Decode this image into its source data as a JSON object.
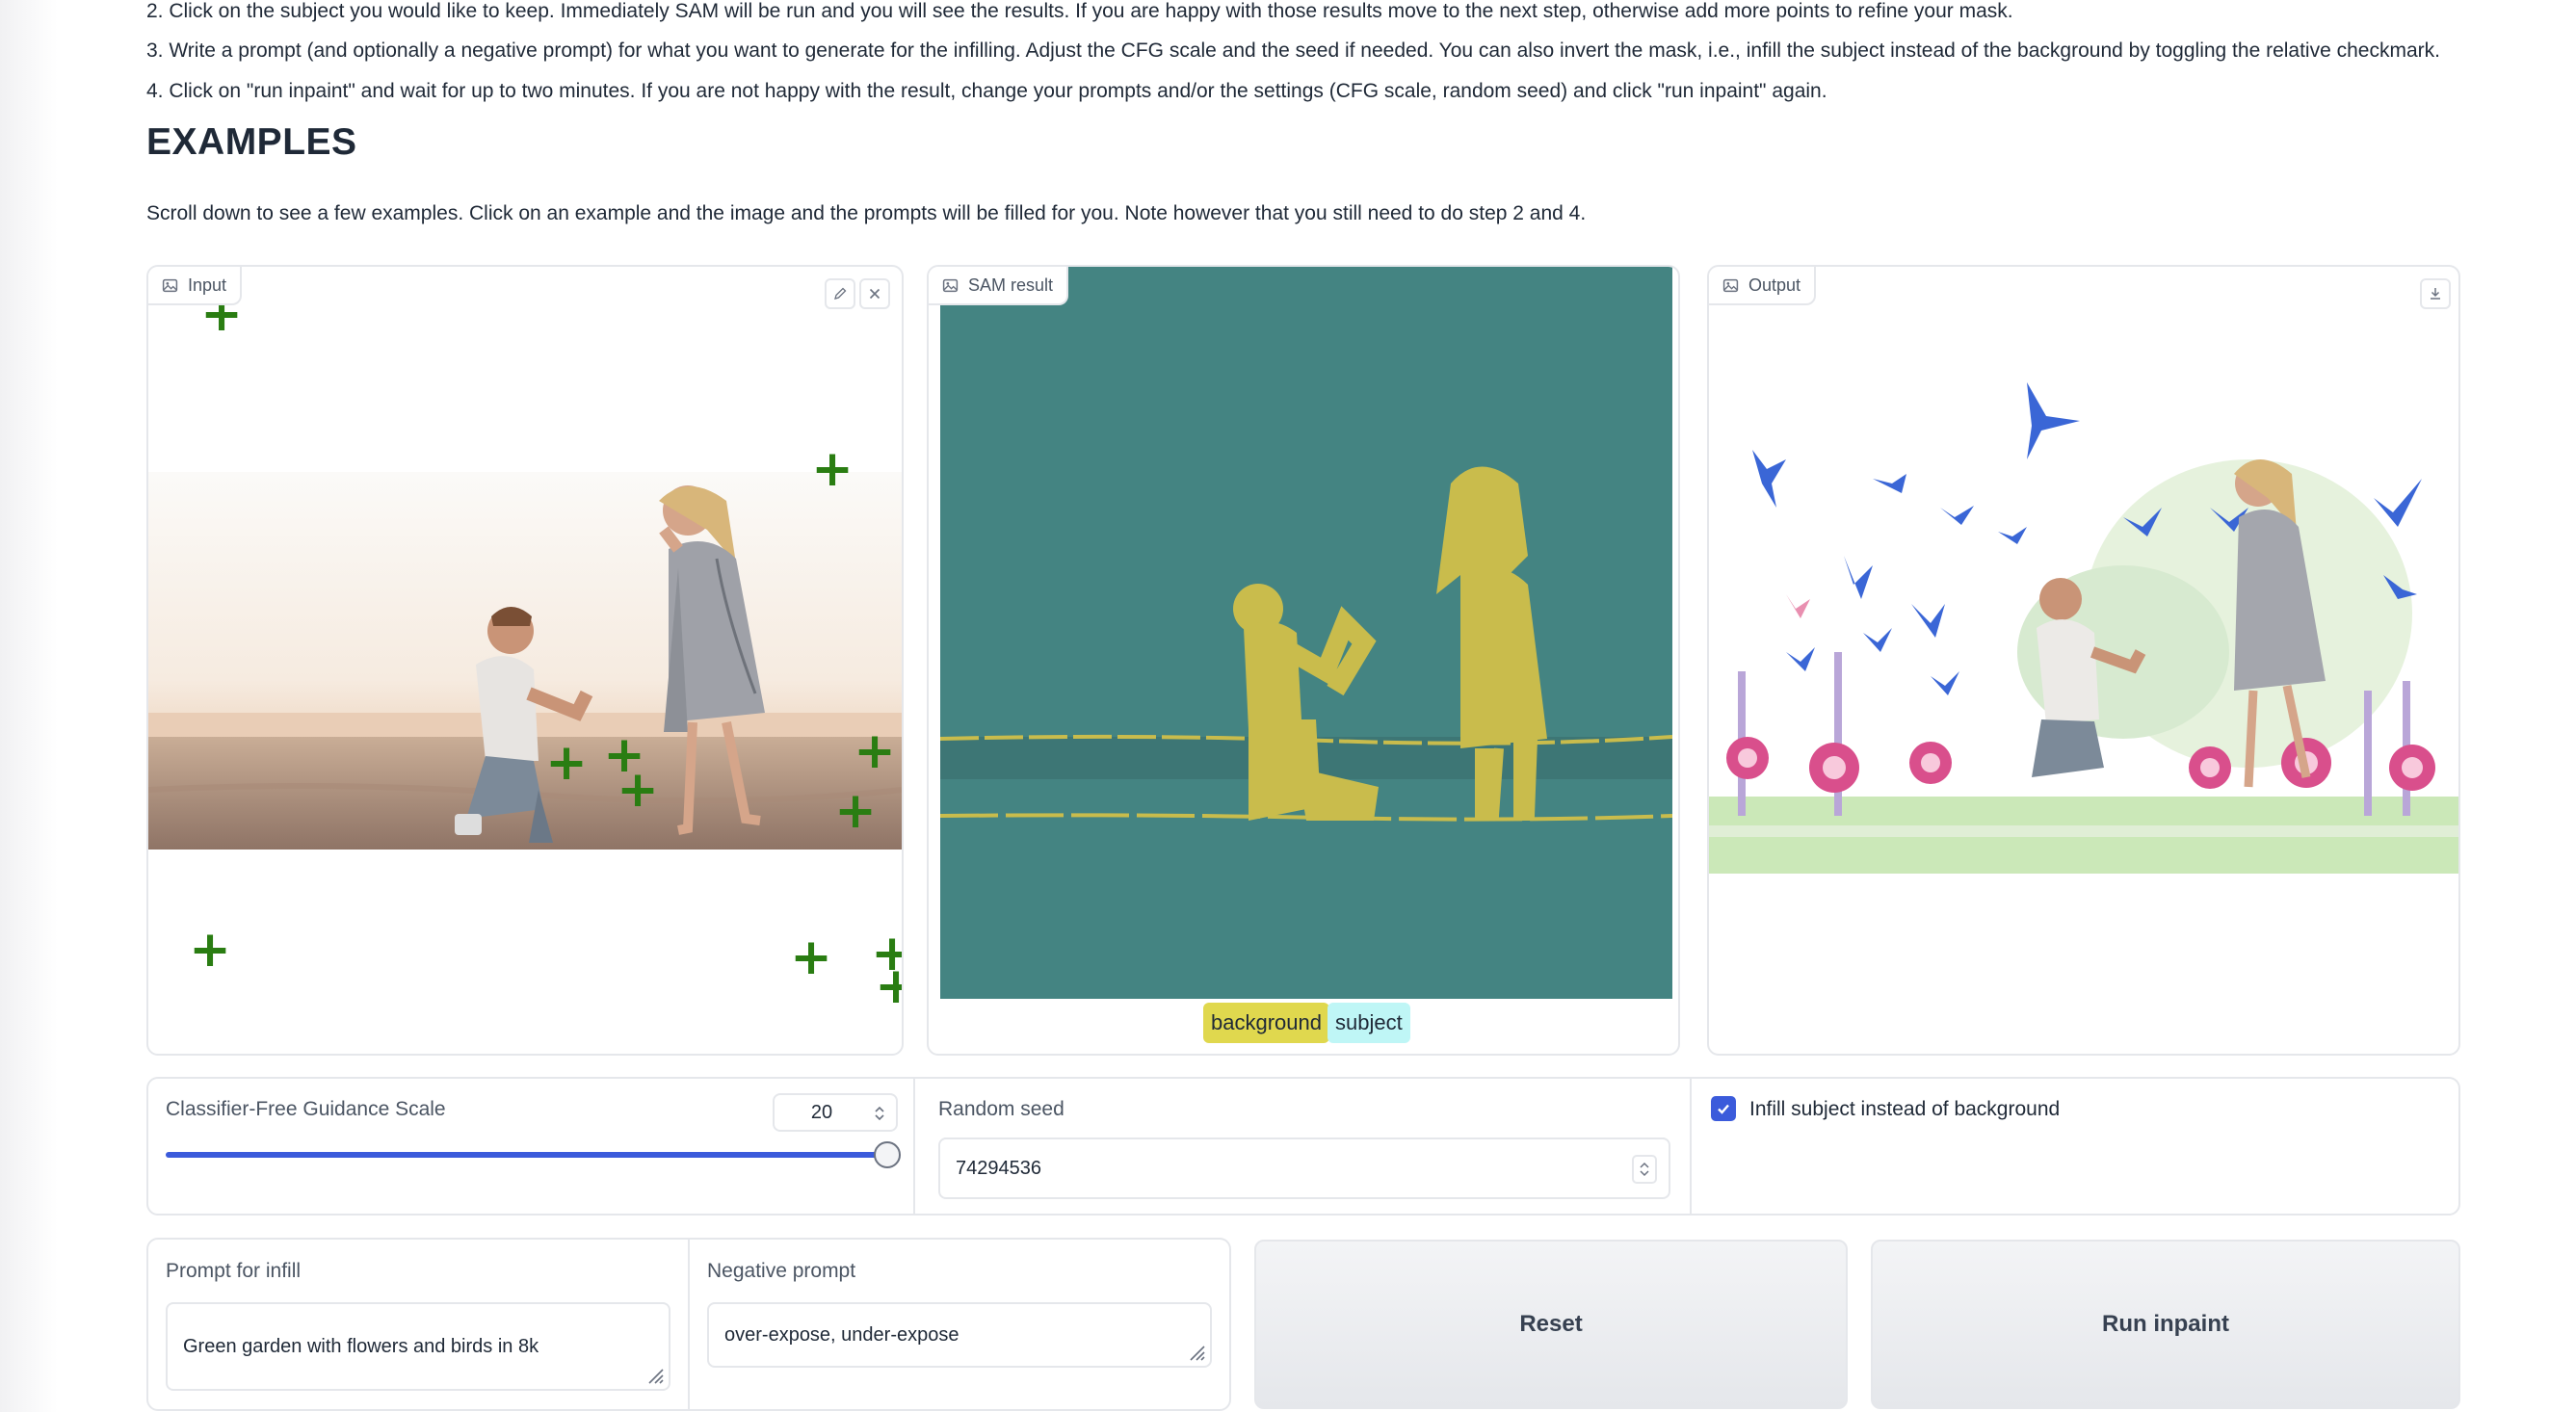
{
  "instructions": {
    "step2": "2. Click on the subject you would like to keep. Immediately SAM will be run and you will see the results. If you are happy with those results move to the next step, otherwise add more points to refine your mask.",
    "step3": "3. Write a prompt (and optionally a negative prompt) for what you want to generate for the infilling. Adjust the CFG scale and the seed if needed. You can also invert the mask, i.e., infill the subject instead of the background by toggling the relative checkmark.",
    "step4": "4. Click on \"run inpaint\" and wait for up to two minutes. If you are not happy with the result, change your prompts and/or the settings (CFG scale, random seed) and click \"run inpaint\" again."
  },
  "examples": {
    "heading": "EXAMPLES",
    "description": "Scroll down to see a few examples. Click on an example and the image and the prompts will be filled for you. Note however that you still need to do step 2 and 4."
  },
  "input_panel": {
    "label": "Input",
    "edit_icon": "pencil-icon",
    "close_icon": "close-icon"
  },
  "sam_panel": {
    "label": "SAM result",
    "legend": [
      "background",
      "subject"
    ],
    "colors": {
      "background_mask": "#e0d84e",
      "subject_mask": "#bff6f6",
      "teal_overlay": "#448482",
      "yellow_overlay": "#c9bc4c"
    }
  },
  "output_panel": {
    "label": "Output",
    "download_icon": "download-icon"
  },
  "cfg": {
    "label": "Classifier-Free Guidance Scale",
    "value": "20",
    "slider_fraction": 1.0,
    "accent": "#3b5bdb"
  },
  "seed": {
    "label": "Random seed",
    "value": "74294536"
  },
  "invert": {
    "label": "Infill subject instead of background",
    "checked": true
  },
  "prompt": {
    "label": "Prompt for infill",
    "value": "Green garden with flowers and birds in 8k"
  },
  "negative_prompt": {
    "label": "Negative prompt",
    "value": "over-expose, under-expose"
  },
  "buttons": {
    "reset": "Reset",
    "run": "Run inpaint"
  }
}
